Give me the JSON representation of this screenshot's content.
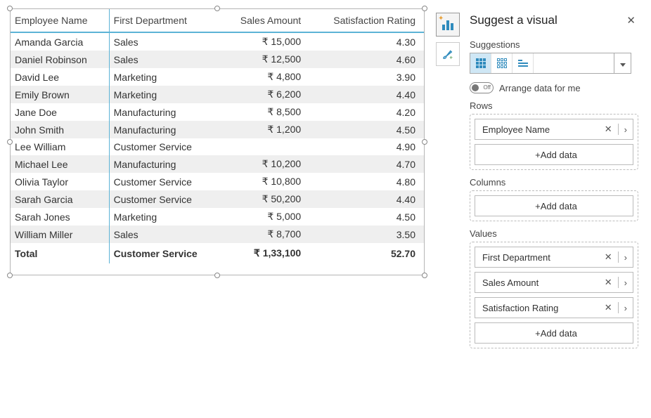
{
  "table": {
    "headers": {
      "employee_name": "Employee Name",
      "first_department": "First Department",
      "sales_amount": "Sales Amount",
      "satisfaction_rating": "Satisfaction Rating"
    },
    "rows": [
      {
        "employee_name": "Amanda Garcia",
        "first_department": "Sales",
        "sales_amount": "₹ 15,000",
        "satisfaction_rating": "4.30"
      },
      {
        "employee_name": "Daniel Robinson",
        "first_department": "Sales",
        "sales_amount": "₹ 12,500",
        "satisfaction_rating": "4.60"
      },
      {
        "employee_name": "David Lee",
        "first_department": "Marketing",
        "sales_amount": "₹ 4,800",
        "satisfaction_rating": "3.90"
      },
      {
        "employee_name": "Emily Brown",
        "first_department": "Marketing",
        "sales_amount": "₹ 6,200",
        "satisfaction_rating": "4.40"
      },
      {
        "employee_name": "Jane Doe",
        "first_department": "Manufacturing",
        "sales_amount": "₹ 8,500",
        "satisfaction_rating": "4.20"
      },
      {
        "employee_name": "John Smith",
        "first_department": "Manufacturing",
        "sales_amount": "₹ 1,200",
        "satisfaction_rating": "4.50"
      },
      {
        "employee_name": "Lee William",
        "first_department": "Customer Service",
        "sales_amount": "",
        "satisfaction_rating": "4.90"
      },
      {
        "employee_name": "Michael Lee",
        "first_department": "Manufacturing",
        "sales_amount": "₹ 10,200",
        "satisfaction_rating": "4.70"
      },
      {
        "employee_name": "Olivia Taylor",
        "first_department": "Customer Service",
        "sales_amount": "₹ 10,800",
        "satisfaction_rating": "4.80"
      },
      {
        "employee_name": "Sarah Garcia",
        "first_department": "Customer Service",
        "sales_amount": "₹ 50,200",
        "satisfaction_rating": "4.40"
      },
      {
        "employee_name": "Sarah Jones",
        "first_department": "Marketing",
        "sales_amount": "₹ 5,000",
        "satisfaction_rating": "4.50"
      },
      {
        "employee_name": "William Miller",
        "first_department": "Sales",
        "sales_amount": "₹ 8,700",
        "satisfaction_rating": "3.50"
      }
    ],
    "total": {
      "label": "Total",
      "first_department": "Customer Service",
      "sales_amount": "₹ 1,33,100",
      "satisfaction_rating": "52.70"
    }
  },
  "pane": {
    "title": "Suggest a visual",
    "suggestions_label": "Suggestions",
    "arrange_toggle_state": "Off",
    "arrange_label": "Arrange data for me",
    "rows_label": "Rows",
    "columns_label": "Columns",
    "values_label": "Values",
    "add_data_label": "+Add data",
    "rows_items": [
      {
        "label": "Employee Name"
      }
    ],
    "values_items": [
      {
        "label": "First Department"
      },
      {
        "label": "Sales Amount"
      },
      {
        "label": "Satisfaction Rating"
      }
    ]
  }
}
